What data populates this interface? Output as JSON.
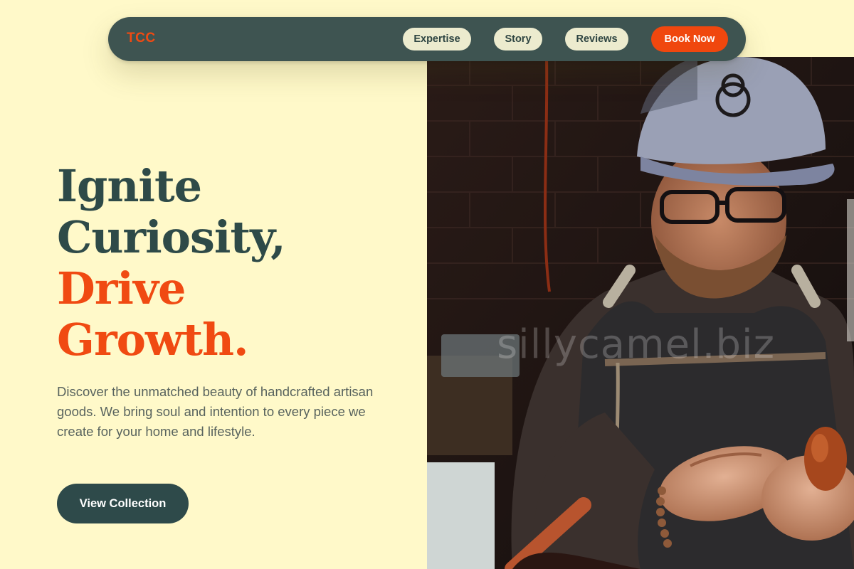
{
  "nav": {
    "logo": "TCC",
    "links": [
      {
        "label": "Expertise"
      },
      {
        "label": "Story"
      },
      {
        "label": "Reviews"
      }
    ],
    "cta_label": "Book Now"
  },
  "hero": {
    "title_line1": "Ignite",
    "title_line2": "Curiosity,",
    "title_line3": "Drive",
    "title_line4": "Growth.",
    "description": "Discover the unmatched beauty of handcrafted artisan goods. We bring soul and intention to every piece we create for your home and lifestyle.",
    "button_label": "View Collection"
  },
  "photo": {
    "watermark": "sillycamel.biz",
    "subject": "craftsman-at-work-photo"
  },
  "colors": {
    "background": "#fff9c9",
    "primary_dark": "#2e4a48",
    "accent": "#f04a12",
    "nav_bg": "#3e5451",
    "pill_bg": "#ecebce"
  }
}
